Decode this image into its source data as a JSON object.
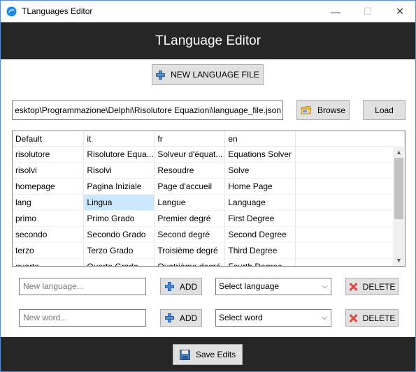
{
  "window": {
    "title": "TLanguages Editor",
    "min": "—",
    "max": "☐",
    "close": "✕"
  },
  "header": {
    "title": "TLanguage Editor"
  },
  "toolbar": {
    "new_language_file": "NEW LANGUAGE FILE"
  },
  "file": {
    "path": "esktop\\Programmazione\\Delphi\\Risolutore Equazioni\\language_file.json",
    "browse": "Browse",
    "load": "Load"
  },
  "grid": {
    "columns": [
      "Default",
      "it",
      "fr",
      "en"
    ],
    "rows": [
      [
        "risolutore",
        "Risolutore Equa...",
        "Solveur d'équat...",
        "Equations Solver"
      ],
      [
        "risolvi",
        "Risolvi",
        "Resoudre",
        "Solve"
      ],
      [
        "homepage",
        "Pagina Iniziale",
        "Page d'accueil",
        "Home Page"
      ],
      [
        "lang",
        "Lingua",
        "Langue",
        "Language"
      ],
      [
        "primo",
        "Primo Grado",
        "Premier degré",
        "First Degree"
      ],
      [
        "secondo",
        "Secondo Grado",
        "Second degré",
        "Second Degree"
      ],
      [
        "terzo",
        "Terzo Grado",
        "Troisième degré",
        "Third Degree"
      ],
      [
        "quarto",
        "Quarto Grado",
        "Quatrième degré",
        "Fourth Degree"
      ]
    ],
    "selected": {
      "row": 3,
      "col": 1
    }
  },
  "language": {
    "placeholder": "New language...",
    "add": "ADD",
    "select": "Select language",
    "delete": "DELETE"
  },
  "word": {
    "placeholder": "New word...",
    "add": "ADD",
    "select": "Select word",
    "delete": "DELETE"
  },
  "footer": {
    "save": "Save Edits"
  },
  "colors": {
    "header_bg": "#262626",
    "selection": "#cce8ff",
    "button_bg": "#e1e1e1"
  }
}
